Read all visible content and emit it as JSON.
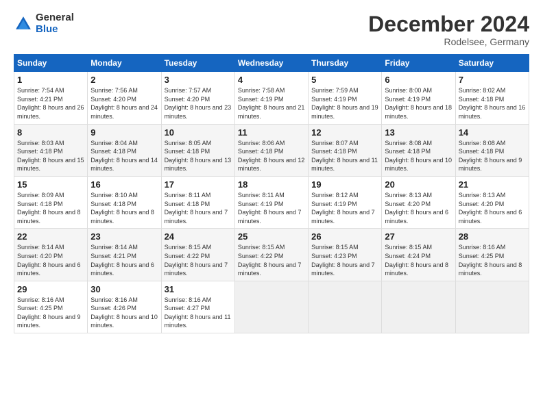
{
  "logo": {
    "general": "General",
    "blue": "Blue"
  },
  "title": "December 2024",
  "subtitle": "Rodelsee, Germany",
  "days_header": [
    "Sunday",
    "Monday",
    "Tuesday",
    "Wednesday",
    "Thursday",
    "Friday",
    "Saturday"
  ],
  "weeks": [
    [
      {
        "day": "1",
        "sunrise": "Sunrise: 7:54 AM",
        "sunset": "Sunset: 4:21 PM",
        "daylight": "Daylight: 8 hours and 26 minutes."
      },
      {
        "day": "2",
        "sunrise": "Sunrise: 7:56 AM",
        "sunset": "Sunset: 4:20 PM",
        "daylight": "Daylight: 8 hours and 24 minutes."
      },
      {
        "day": "3",
        "sunrise": "Sunrise: 7:57 AM",
        "sunset": "Sunset: 4:20 PM",
        "daylight": "Daylight: 8 hours and 23 minutes."
      },
      {
        "day": "4",
        "sunrise": "Sunrise: 7:58 AM",
        "sunset": "Sunset: 4:19 PM",
        "daylight": "Daylight: 8 hours and 21 minutes."
      },
      {
        "day": "5",
        "sunrise": "Sunrise: 7:59 AM",
        "sunset": "Sunset: 4:19 PM",
        "daylight": "Daylight: 8 hours and 19 minutes."
      },
      {
        "day": "6",
        "sunrise": "Sunrise: 8:00 AM",
        "sunset": "Sunset: 4:19 PM",
        "daylight": "Daylight: 8 hours and 18 minutes."
      },
      {
        "day": "7",
        "sunrise": "Sunrise: 8:02 AM",
        "sunset": "Sunset: 4:18 PM",
        "daylight": "Daylight: 8 hours and 16 minutes."
      }
    ],
    [
      {
        "day": "8",
        "sunrise": "Sunrise: 8:03 AM",
        "sunset": "Sunset: 4:18 PM",
        "daylight": "Daylight: 8 hours and 15 minutes."
      },
      {
        "day": "9",
        "sunrise": "Sunrise: 8:04 AM",
        "sunset": "Sunset: 4:18 PM",
        "daylight": "Daylight: 8 hours and 14 minutes."
      },
      {
        "day": "10",
        "sunrise": "Sunrise: 8:05 AM",
        "sunset": "Sunset: 4:18 PM",
        "daylight": "Daylight: 8 hours and 13 minutes."
      },
      {
        "day": "11",
        "sunrise": "Sunrise: 8:06 AM",
        "sunset": "Sunset: 4:18 PM",
        "daylight": "Daylight: 8 hours and 12 minutes."
      },
      {
        "day": "12",
        "sunrise": "Sunrise: 8:07 AM",
        "sunset": "Sunset: 4:18 PM",
        "daylight": "Daylight: 8 hours and 11 minutes."
      },
      {
        "day": "13",
        "sunrise": "Sunrise: 8:08 AM",
        "sunset": "Sunset: 4:18 PM",
        "daylight": "Daylight: 8 hours and 10 minutes."
      },
      {
        "day": "14",
        "sunrise": "Sunrise: 8:08 AM",
        "sunset": "Sunset: 4:18 PM",
        "daylight": "Daylight: 8 hours and 9 minutes."
      }
    ],
    [
      {
        "day": "15",
        "sunrise": "Sunrise: 8:09 AM",
        "sunset": "Sunset: 4:18 PM",
        "daylight": "Daylight: 8 hours and 8 minutes."
      },
      {
        "day": "16",
        "sunrise": "Sunrise: 8:10 AM",
        "sunset": "Sunset: 4:18 PM",
        "daylight": "Daylight: 8 hours and 8 minutes."
      },
      {
        "day": "17",
        "sunrise": "Sunrise: 8:11 AM",
        "sunset": "Sunset: 4:18 PM",
        "daylight": "Daylight: 8 hours and 7 minutes."
      },
      {
        "day": "18",
        "sunrise": "Sunrise: 8:11 AM",
        "sunset": "Sunset: 4:19 PM",
        "daylight": "Daylight: 8 hours and 7 minutes."
      },
      {
        "day": "19",
        "sunrise": "Sunrise: 8:12 AM",
        "sunset": "Sunset: 4:19 PM",
        "daylight": "Daylight: 8 hours and 7 minutes."
      },
      {
        "day": "20",
        "sunrise": "Sunrise: 8:13 AM",
        "sunset": "Sunset: 4:20 PM",
        "daylight": "Daylight: 8 hours and 6 minutes."
      },
      {
        "day": "21",
        "sunrise": "Sunrise: 8:13 AM",
        "sunset": "Sunset: 4:20 PM",
        "daylight": "Daylight: 8 hours and 6 minutes."
      }
    ],
    [
      {
        "day": "22",
        "sunrise": "Sunrise: 8:14 AM",
        "sunset": "Sunset: 4:20 PM",
        "daylight": "Daylight: 8 hours and 6 minutes."
      },
      {
        "day": "23",
        "sunrise": "Sunrise: 8:14 AM",
        "sunset": "Sunset: 4:21 PM",
        "daylight": "Daylight: 8 hours and 6 minutes."
      },
      {
        "day": "24",
        "sunrise": "Sunrise: 8:15 AM",
        "sunset": "Sunset: 4:22 PM",
        "daylight": "Daylight: 8 hours and 7 minutes."
      },
      {
        "day": "25",
        "sunrise": "Sunrise: 8:15 AM",
        "sunset": "Sunset: 4:22 PM",
        "daylight": "Daylight: 8 hours and 7 minutes."
      },
      {
        "day": "26",
        "sunrise": "Sunrise: 8:15 AM",
        "sunset": "Sunset: 4:23 PM",
        "daylight": "Daylight: 8 hours and 7 minutes."
      },
      {
        "day": "27",
        "sunrise": "Sunrise: 8:15 AM",
        "sunset": "Sunset: 4:24 PM",
        "daylight": "Daylight: 8 hours and 8 minutes."
      },
      {
        "day": "28",
        "sunrise": "Sunrise: 8:16 AM",
        "sunset": "Sunset: 4:25 PM",
        "daylight": "Daylight: 8 hours and 8 minutes."
      }
    ],
    [
      {
        "day": "29",
        "sunrise": "Sunrise: 8:16 AM",
        "sunset": "Sunset: 4:25 PM",
        "daylight": "Daylight: 8 hours and 9 minutes."
      },
      {
        "day": "30",
        "sunrise": "Sunrise: 8:16 AM",
        "sunset": "Sunset: 4:26 PM",
        "daylight": "Daylight: 8 hours and 10 minutes."
      },
      {
        "day": "31",
        "sunrise": "Sunrise: 8:16 AM",
        "sunset": "Sunset: 4:27 PM",
        "daylight": "Daylight: 8 hours and 11 minutes."
      },
      null,
      null,
      null,
      null
    ]
  ]
}
